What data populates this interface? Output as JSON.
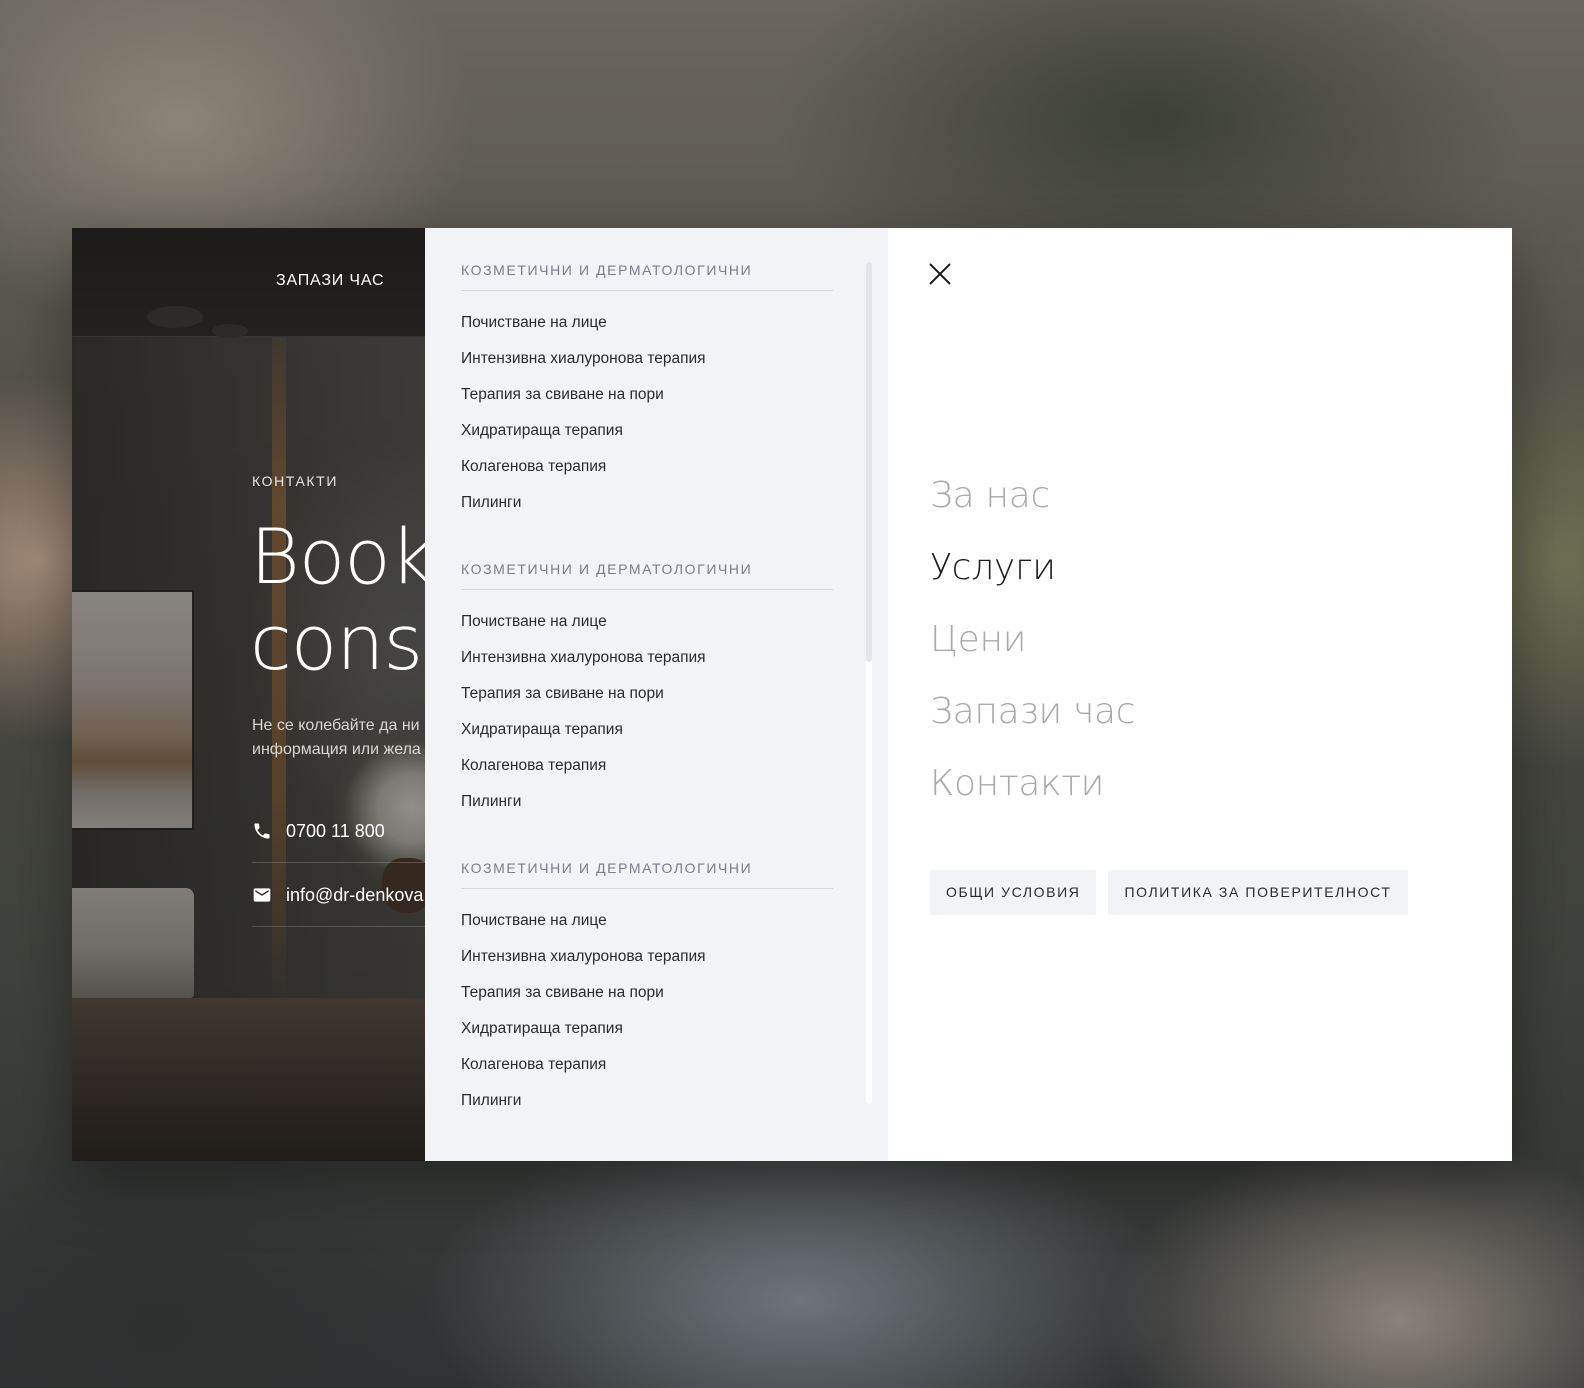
{
  "left_panel": {
    "book_button": "ЗАПАЗИ ЧАС",
    "eyebrow": "КОНТАКТИ",
    "title": "Book\nconsu",
    "text": "Не се колебайте да ни\nинформация или жела",
    "phone": "0700 11 800",
    "email": "info@dr-denkova"
  },
  "services": {
    "groups": [
      {
        "title": "КОЗМЕТИЧНИ И ДЕРМАТОЛОГИЧНИ",
        "items": [
          "Почистване на лице",
          "Интензивна хиалуронова терапия",
          "Терапия за свиване на пори",
          "Хидратираща терапия",
          "Колагенова терапия",
          "Пилинги"
        ]
      },
      {
        "title": "КОЗМЕТИЧНИ И ДЕРМАТОЛОГИЧНИ",
        "items": [
          "Почистване на лице",
          "Интензивна хиалуронова терапия",
          "Терапия за свиване на пори",
          "Хидратираща терапия",
          "Колагенова терапия",
          "Пилинги"
        ]
      },
      {
        "title": "КОЗМЕТИЧНИ И ДЕРМАТОЛОГИЧНИ",
        "items": [
          "Почистване на лице",
          "Интензивна хиалуронова терапия",
          "Терапия за свиване на пори",
          "Хидратираща терапия",
          "Колагенова терапия",
          "Пилинги"
        ]
      }
    ]
  },
  "nav": {
    "items": [
      {
        "label": "За нас",
        "active": false
      },
      {
        "label": "Услуги",
        "active": true
      },
      {
        "label": "Цени",
        "active": false
      },
      {
        "label": "Запази час",
        "active": false
      },
      {
        "label": "Контакти",
        "active": false
      }
    ],
    "links": [
      "ОБЩИ УСЛОВИЯ",
      "ПОЛИТИКА ЗА ПОВЕРИТЕЛНОСТ"
    ]
  },
  "icons": {
    "close": "close-icon",
    "phone": "phone-icon",
    "email": "mail-icon"
  },
  "colors": {
    "nav_active": "#1b1c1f",
    "nav_inactive": "#a7a9ae",
    "services_bg": "#f2f3f7"
  }
}
